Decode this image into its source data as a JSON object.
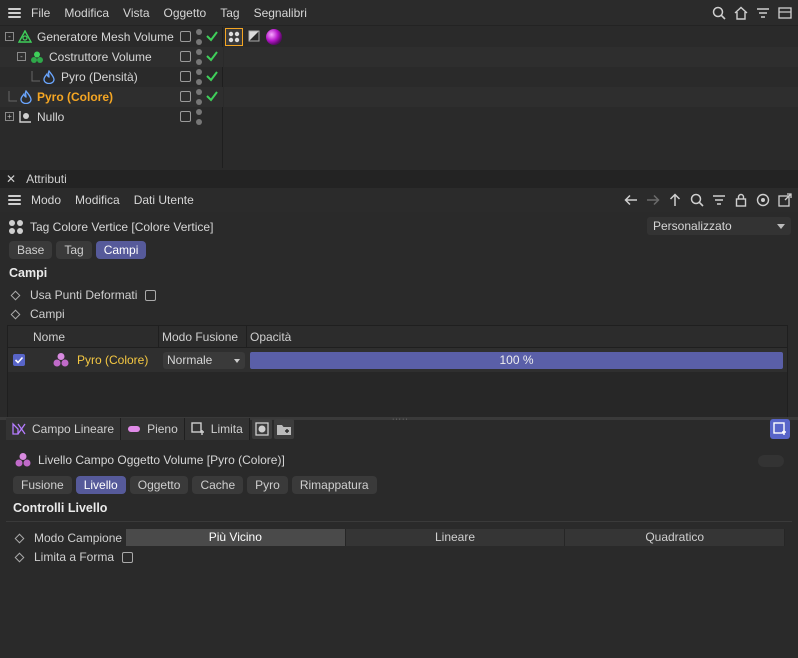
{
  "menubar": {
    "items": [
      "File",
      "Modifica",
      "Vista",
      "Oggetto",
      "Tag",
      "Segnalibri"
    ],
    "right_icons": [
      "search-icon",
      "home-icon",
      "filter-icon",
      "layers-icon"
    ]
  },
  "objects": [
    {
      "name": "Generatore Mesh Volume",
      "icon": "volume-mesher-icon",
      "expander": "-",
      "selected": false
    },
    {
      "name": "Costruttore Volume",
      "icon": "volume-builder-icon",
      "expander": "-",
      "selected": false
    },
    {
      "name": "Pyro (Densità)",
      "icon": "pyro-icon",
      "expander": "",
      "selected": false
    },
    {
      "name": "Pyro (Colore)",
      "icon": "pyro-icon",
      "expander": "",
      "selected": true
    },
    {
      "name": "Nullo",
      "icon": "null-icon",
      "expander": "+",
      "selected": false
    }
  ],
  "attributes": {
    "panel_title": "Attributi",
    "menu": [
      "Modo",
      "Modifica",
      "Dati Utente"
    ],
    "tag_title": "Tag Colore Vertice [Colore Vertice]",
    "preset": "Personalizzato",
    "tabs": [
      "Base",
      "Tag",
      "Campi"
    ],
    "active_tab": "Campi",
    "section_title": "Campi",
    "prop_use_deformed": "Usa Punti Deformati",
    "prop_fields": "Campi",
    "table": {
      "headers": [
        "Nome",
        "Modo Fusione",
        "Opacità"
      ],
      "row": {
        "name": "Pyro (Colore)",
        "mode": "Normale",
        "opacity": "100 %",
        "opacity_value": 1.0,
        "checked": true
      }
    },
    "field_buttons": [
      "Campo Lineare",
      "Pieno",
      "Limita"
    ],
    "layer_title": "Livello Campo Oggetto Volume [Pyro (Colore)]",
    "layer_tabs": [
      "Fusione",
      "Livello",
      "Oggetto",
      "Cache",
      "Pyro",
      "Rimappatura"
    ],
    "layer_active_tab": "Livello",
    "layer_section": "Controlli Livello",
    "sample_mode_label": "Modo Campione",
    "sample_modes": [
      "Più Vicino",
      "Lineare",
      "Quadratico"
    ],
    "sample_mode_active": "Più Vicino",
    "clamp_label": "Limita a Forma"
  },
  "colors": {
    "accent": "#565a9a",
    "selected_text": "#f5a623",
    "check_green": "#3fcf5a"
  }
}
